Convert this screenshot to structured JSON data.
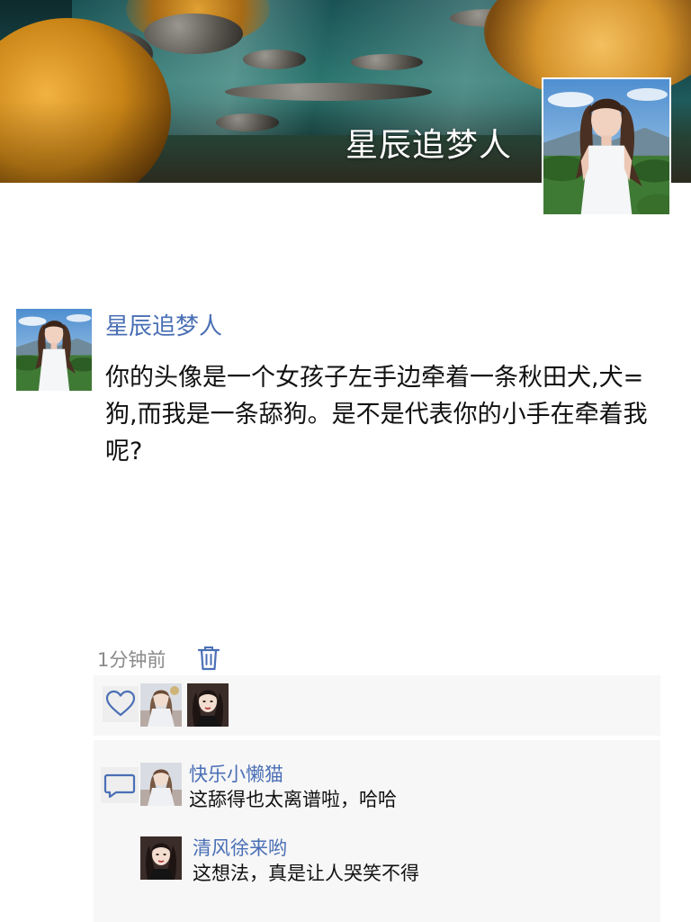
{
  "profile": {
    "name": "星辰追梦人"
  },
  "post": {
    "author": "星辰追梦人",
    "text": "你的头像是一个女孩子左手边牵着一条秋田犬,犬=狗,而我是一条舔狗。是不是代表你的小手在牵着我呢?",
    "time": "1分钟前"
  },
  "likes": {
    "icon": "heart-icon"
  },
  "comments": [
    {
      "author": "快乐小懒猫",
      "text": "这舔得也太离谱啦，哈哈"
    },
    {
      "author": "清风徐来哟",
      "text": "这想法，真是让人哭笑不得"
    }
  ],
  "colors": {
    "link": "#4a6fb5",
    "meta": "#8a8a8a",
    "panel": "#f7f7f7"
  }
}
